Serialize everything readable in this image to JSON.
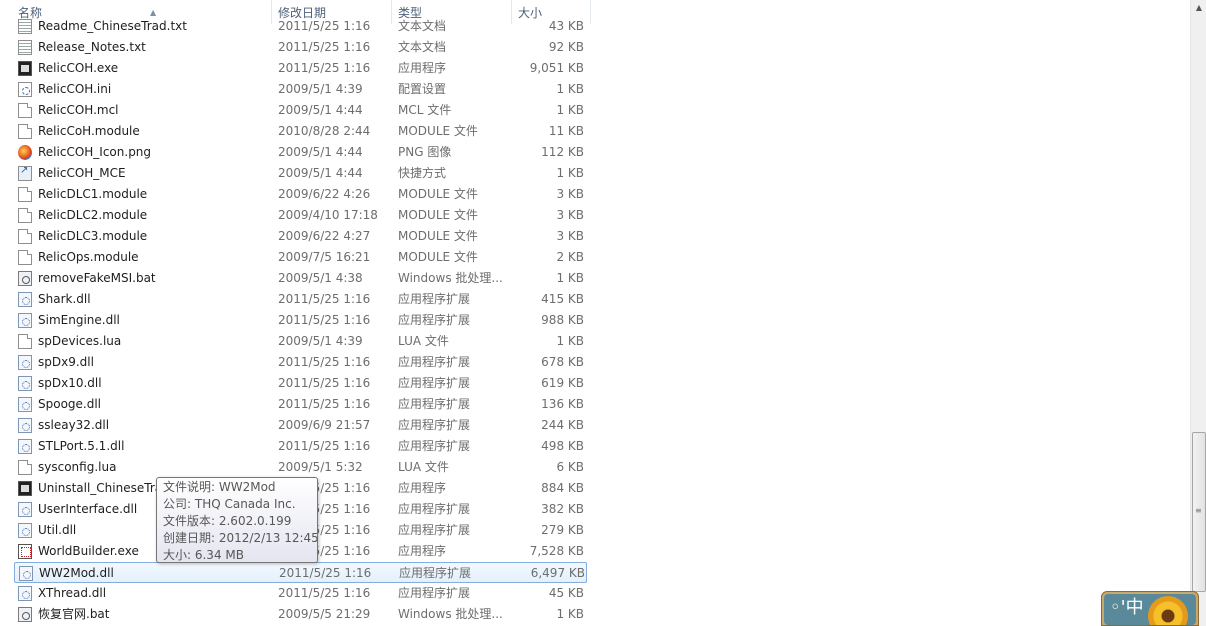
{
  "columns": {
    "name": "名称",
    "date": "修改日期",
    "type": "类型",
    "size": "大小"
  },
  "files": [
    {
      "name": "Readme_ChineseTrad.txt",
      "date": "2011/5/25 1:16",
      "type": "文本文档",
      "size": "43 KB",
      "icon": "text-file-icon"
    },
    {
      "name": "Release_Notes.txt",
      "date": "2011/5/25 1:16",
      "type": "文本文档",
      "size": "92 KB",
      "icon": "text-file-icon"
    },
    {
      "name": "RelicCOH.exe",
      "date": "2011/5/25 1:16",
      "type": "应用程序",
      "size": "9,051 KB",
      "icon": "exe-icon"
    },
    {
      "name": "RelicCOH.ini",
      "date": "2009/5/1 4:39",
      "type": "配置设置",
      "size": "1 KB",
      "icon": "config-file-icon"
    },
    {
      "name": "RelicCOH.mcl",
      "date": "2009/5/1 4:44",
      "type": "MCL 文件",
      "size": "1 KB",
      "icon": "blank-file-icon"
    },
    {
      "name": "RelicCoH.module",
      "date": "2010/8/28 2:44",
      "type": "MODULE 文件",
      "size": "11 KB",
      "icon": "blank-file-icon"
    },
    {
      "name": "RelicCOH_Icon.png",
      "date": "2009/5/1 4:44",
      "type": "PNG 图像",
      "size": "112 KB",
      "icon": "png-image-icon"
    },
    {
      "name": "RelicCOH_MCE",
      "date": "2009/5/1 4:44",
      "type": "快捷方式",
      "size": "1 KB",
      "icon": "shortcut-icon"
    },
    {
      "name": "RelicDLC1.module",
      "date": "2009/6/22 4:26",
      "type": "MODULE 文件",
      "size": "3 KB",
      "icon": "blank-file-icon"
    },
    {
      "name": "RelicDLC2.module",
      "date": "2009/4/10 17:18",
      "type": "MODULE 文件",
      "size": "3 KB",
      "icon": "blank-file-icon"
    },
    {
      "name": "RelicDLC3.module",
      "date": "2009/6/22 4:27",
      "type": "MODULE 文件",
      "size": "3 KB",
      "icon": "blank-file-icon"
    },
    {
      "name": "RelicOps.module",
      "date": "2009/7/5 16:21",
      "type": "MODULE 文件",
      "size": "2 KB",
      "icon": "blank-file-icon"
    },
    {
      "name": "removeFakeMSI.bat",
      "date": "2009/5/1 4:38",
      "type": "Windows 批处理...",
      "size": "1 KB",
      "icon": "batch-file-icon"
    },
    {
      "name": "Shark.dll",
      "date": "2011/5/25 1:16",
      "type": "应用程序扩展",
      "size": "415 KB",
      "icon": "dll-icon"
    },
    {
      "name": "SimEngine.dll",
      "date": "2011/5/25 1:16",
      "type": "应用程序扩展",
      "size": "988 KB",
      "icon": "dll-icon"
    },
    {
      "name": "spDevices.lua",
      "date": "2009/5/1 4:39",
      "type": "LUA 文件",
      "size": "1 KB",
      "icon": "blank-file-icon"
    },
    {
      "name": "spDx9.dll",
      "date": "2011/5/25 1:16",
      "type": "应用程序扩展",
      "size": "678 KB",
      "icon": "dll-icon"
    },
    {
      "name": "spDx10.dll",
      "date": "2011/5/25 1:16",
      "type": "应用程序扩展",
      "size": "619 KB",
      "icon": "dll-icon"
    },
    {
      "name": "Spooge.dll",
      "date": "2011/5/25 1:16",
      "type": "应用程序扩展",
      "size": "136 KB",
      "icon": "dll-icon"
    },
    {
      "name": "ssleay32.dll",
      "date": "2009/6/9 21:57",
      "type": "应用程序扩展",
      "size": "244 KB",
      "icon": "dll-icon"
    },
    {
      "name": "STLPort.5.1.dll",
      "date": "2011/5/25 1:16",
      "type": "应用程序扩展",
      "size": "498 KB",
      "icon": "dll-icon"
    },
    {
      "name": "sysconfig.lua",
      "date": "2009/5/1 5:32",
      "type": "LUA 文件",
      "size": "6 KB",
      "icon": "blank-file-icon"
    },
    {
      "name": "Uninstall_ChineseTrad.exe",
      "date": "2011/5/25 1:16",
      "type": "应用程序",
      "size": "884 KB",
      "icon": "exe-icon"
    },
    {
      "name": "UserInterface.dll",
      "date": "2011/5/25 1:16",
      "type": "应用程序扩展",
      "size": "382 KB",
      "icon": "dll-icon"
    },
    {
      "name": "Util.dll",
      "date": "2011/5/25 1:16",
      "type": "应用程序扩展",
      "size": "279 KB",
      "icon": "dll-icon"
    },
    {
      "name": "WorldBuilder.exe",
      "date": "2011/5/25 1:16",
      "type": "应用程序",
      "size": "7,528 KB",
      "icon": "worldbuilder-exe-icon"
    },
    {
      "name": "WW2Mod.dll",
      "date": "2011/5/25 1:16",
      "type": "应用程序扩展",
      "size": "6,497 KB",
      "icon": "dll-icon",
      "selected": true
    },
    {
      "name": "XThread.dll",
      "date": "2011/5/25 1:16",
      "type": "应用程序扩展",
      "size": "45 KB",
      "icon": "dll-icon"
    },
    {
      "name": "恢复官网.bat",
      "date": "2009/5/5 21:29",
      "type": "Windows 批处理...",
      "size": "1 KB",
      "icon": "batch-file-icon"
    }
  ],
  "tooltip": {
    "description": "文件说明: WW2Mod",
    "company": "公司: THQ Canada Inc.",
    "version": "文件版本: 2.602.0.199",
    "created": "创建日期: 2012/2/13 12:45",
    "size": "大小: 6.34 MB"
  },
  "ime": {
    "label": "中"
  }
}
